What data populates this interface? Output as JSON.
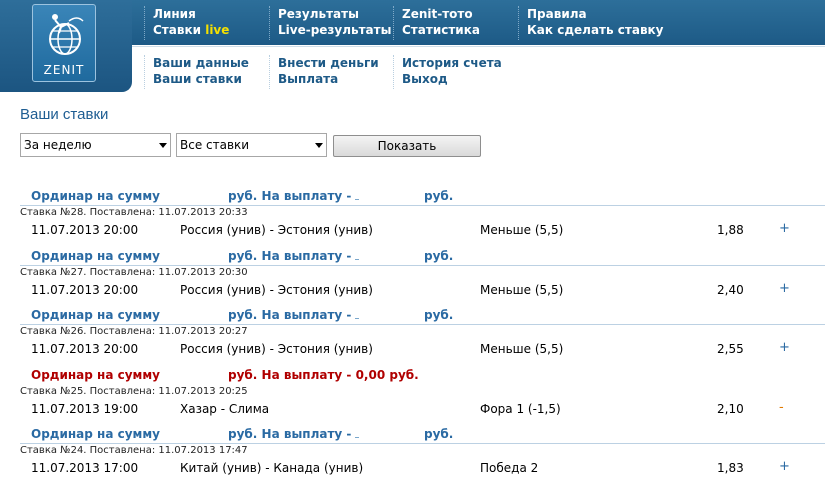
{
  "logo": {
    "text": "ZENIT"
  },
  "nav_top": [
    {
      "links": [
        "Линия",
        "Ставки"
      ],
      "live_label": "live"
    },
    {
      "links": [
        "Результаты",
        "Live-результаты"
      ]
    },
    {
      "links": [
        "Zenit-тото",
        "Статистика"
      ]
    },
    {
      "links": [
        "Правила",
        "Как сделать ставку"
      ]
    }
  ],
  "nav_bottom": [
    {
      "links": [
        "Ваши данные",
        "Ваши ставки"
      ]
    },
    {
      "links": [
        "Внести деньги",
        "Выплата"
      ]
    },
    {
      "links": [
        "История счета",
        "Выход"
      ]
    }
  ],
  "page_title": "Ваши ставки",
  "filters": {
    "period": "За неделю",
    "type": "Все ставки",
    "show_button": "Показать"
  },
  "bets": [
    {
      "label": "Ординар на сумму",
      "sum": "руб.  На выплату -",
      "payout": "руб.",
      "status": "normal",
      "meta": "Ставка №28. Поставлена: 11.07.2013 20:33",
      "date": "11.07.2013 20:00",
      "event": "Россия (унив) - Эстония (унив)",
      "outcome": "Меньше (5,5)",
      "odds": "1,88",
      "expand": "+"
    },
    {
      "label": "Ординар на сумму",
      "sum": "руб.  На выплату -",
      "payout": "руб.",
      "status": "normal",
      "meta": "Ставка №27. Поставлена: 11.07.2013 20:30",
      "date": "11.07.2013 20:00",
      "event": "Россия (унив) - Эстония (унив)",
      "outcome": "Меньше (5,5)",
      "odds": "2,40",
      "expand": "+"
    },
    {
      "label": "Ординар на сумму",
      "sum": "руб.  На выплату -",
      "payout": "руб.",
      "status": "normal",
      "meta": "Ставка №26. Поставлена: 11.07.2013 20:27",
      "date": "11.07.2013 20:00",
      "event": "Россия (унив) - Эстония (унив)",
      "outcome": "Меньше (5,5)",
      "odds": "2,55",
      "expand": "+"
    },
    {
      "label": "Ординар на сумму",
      "sum": "руб.  На выплату - 0,00 руб.",
      "payout": "",
      "status": "lost",
      "meta": "Ставка №25. Поставлена: 11.07.2013 20:25",
      "date": "11.07.2013 19:00",
      "event": "Хазар - Слима",
      "outcome": "Фора 1 (-1,5)",
      "odds": "2,10",
      "expand": "-"
    },
    {
      "label": "Ординар на сумму",
      "sum": "руб.  На выплату -",
      "payout": "руб.",
      "status": "normal",
      "meta": "Ставка №24. Поставлена: 11.07.2013 17:47",
      "date": "11.07.2013 17:00",
      "event": "Китай (унив) - Канада (унив)",
      "outcome": "Победа 2",
      "odds": "1,83",
      "expand": "+"
    }
  ]
}
